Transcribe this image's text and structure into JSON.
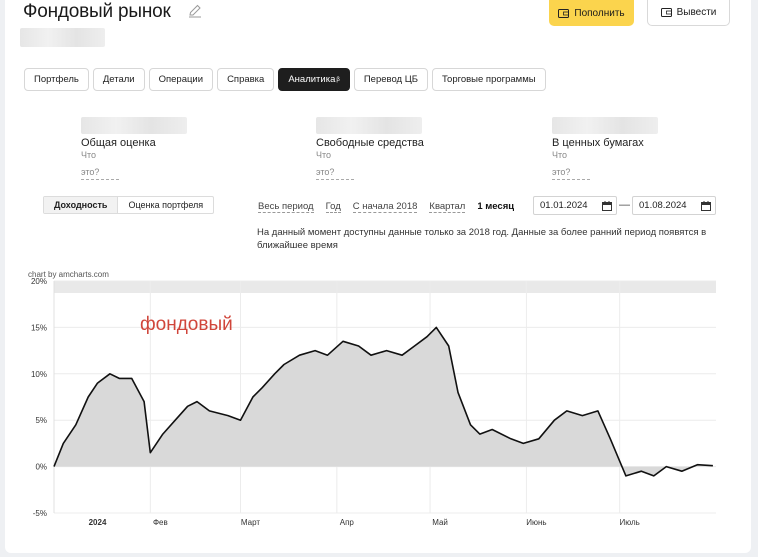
{
  "header": {
    "title": "Фондовый рынок",
    "deposit_label": "Пополнить",
    "withdraw_label": "Вывести"
  },
  "tabs": [
    {
      "label": "Портфель",
      "active": false
    },
    {
      "label": "Детали",
      "active": false
    },
    {
      "label": "Операции",
      "active": false
    },
    {
      "label": "Справка",
      "active": false
    },
    {
      "label": "Аналитика",
      "sup": "β",
      "active": true
    },
    {
      "label": "Перевод ЦБ",
      "active": false
    },
    {
      "label": "Торговые программы",
      "active": false
    }
  ],
  "stats": [
    {
      "label": "Общая оценка",
      "hint1": "Что",
      "hint2": "это?"
    },
    {
      "label": "Свободные средства",
      "hint1": "Что",
      "hint2": "это?"
    },
    {
      "label": "В ценных бумагах",
      "hint1": "Что",
      "hint2": "это?"
    }
  ],
  "toggle": {
    "yield": "Доходность",
    "portfolio": "Оценка портфеля"
  },
  "periods": [
    "Весь период",
    "Год",
    "С начала 2018",
    "Квартал",
    "1 месяц"
  ],
  "selected_period": "1 месяц",
  "date_from": "01.01.2024",
  "date_to": "01.08.2024",
  "date_separator": "—",
  "notice": "На данный момент доступны данные только за 2018 год. Данные за более ранний период появятся в ближайшее время",
  "credit": "chart by amcharts.com",
  "colors": {
    "accent": "#fbd44d",
    "annotation": "#d0453a",
    "fill": "#d9d9d9",
    "line": "#111111"
  },
  "chart_data": {
    "type": "area",
    "annotation": "фондовый",
    "y_ticks": [
      "20%",
      "15%",
      "10%",
      "5%",
      "0%",
      "-5%"
    ],
    "x_ticks": [
      "2024",
      "Фев",
      "Март",
      "Апр",
      "Май",
      "Июнь",
      "Июль"
    ],
    "ylim": [
      -5,
      20
    ],
    "grid": true,
    "series": [
      {
        "x": [
          "2024-01-01",
          "2024-01-04",
          "2024-01-08",
          "2024-01-12",
          "2024-01-15",
          "2024-01-19",
          "2024-01-22",
          "2024-01-26",
          "2024-01-30",
          "2024-02-01",
          "2024-02-05",
          "2024-02-09",
          "2024-02-13",
          "2024-02-16",
          "2024-02-20",
          "2024-02-26",
          "2024-03-01",
          "2024-03-05",
          "2024-03-08",
          "2024-03-12",
          "2024-03-15",
          "2024-03-20",
          "2024-03-25",
          "2024-03-29",
          "2024-04-03",
          "2024-04-08",
          "2024-04-12",
          "2024-04-17",
          "2024-04-22",
          "2024-04-26",
          "2024-04-30",
          "2024-05-03",
          "2024-05-07",
          "2024-05-10",
          "2024-05-14",
          "2024-05-17",
          "2024-05-21",
          "2024-05-27",
          "2024-05-31",
          "2024-06-05",
          "2024-06-10",
          "2024-06-14",
          "2024-06-19",
          "2024-06-24",
          "2024-06-28",
          "2024-07-03",
          "2024-07-08",
          "2024-07-12",
          "2024-07-16",
          "2024-07-21",
          "2024-07-26",
          "2024-07-31"
        ],
        "values": [
          0,
          2.5,
          4.5,
          7.5,
          9,
          10,
          9.5,
          9.5,
          7,
          1.5,
          3.5,
          5,
          6.5,
          7,
          6,
          5.5,
          5,
          7.5,
          8.5,
          10,
          11,
          12,
          12.5,
          12,
          13.5,
          13,
          12,
          12.5,
          12,
          13,
          14,
          15,
          13,
          8,
          4.5,
          3.5,
          4,
          3,
          2.5,
          3,
          5,
          6,
          5.5,
          6,
          3,
          -1,
          -0.5,
          -1,
          0,
          -0.5,
          0.2,
          0.1
        ]
      }
    ]
  }
}
